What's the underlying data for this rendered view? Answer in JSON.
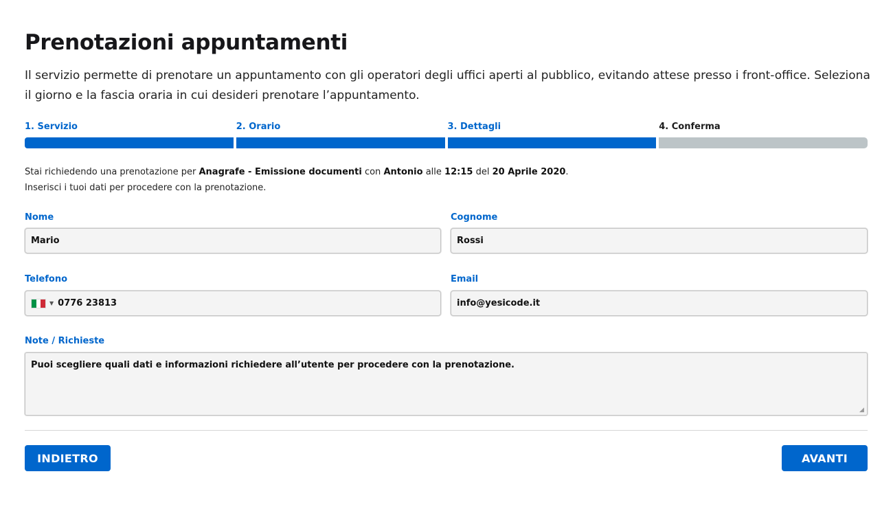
{
  "page": {
    "title": "Prenotazioni appuntamenti",
    "intro": "Il servizio permette di prenotare un appuntamento con gli operatori degli uffici aperti al pubblico, evitando attese presso i front-office. Seleziona il giorno e la fascia oraria in cui desideri prenotare l’appuntamento."
  },
  "steps": [
    {
      "label": "1. Servizio",
      "status": "done"
    },
    {
      "label": "2. Orario",
      "status": "done"
    },
    {
      "label": "3. Dettagli",
      "status": "done"
    },
    {
      "label": "4. Conferma",
      "status": "todo"
    }
  ],
  "summary": {
    "prefix": "Stai richiedendo una prenotazione per",
    "service": "Anagrafe - Emissione documenti",
    "with_word": "con",
    "operator": "Antonio",
    "at_word": "alle",
    "time": "12:15",
    "of_word": "del",
    "date": "20 Aprile 2020",
    "period": ".",
    "line2": "Inserisci i tuoi dati per procedere con la prenotazione."
  },
  "form": {
    "nome": {
      "label": "Nome",
      "value": "Mario"
    },
    "cognome": {
      "label": "Cognome",
      "value": "Rossi"
    },
    "telefono": {
      "label": "Telefono",
      "value": "0776 23813",
      "country_flag": "italy-flag-icon"
    },
    "email": {
      "label": "Email",
      "value": "info@yesicode.it"
    },
    "note": {
      "label": "Note / Richieste",
      "value": "Puoi scegliere quali dati e informazioni richiedere all’utente per procedere con la prenotazione."
    }
  },
  "buttons": {
    "back": "INDIETRO",
    "next": "AVANTI"
  },
  "colors": {
    "accent": "#0066cc",
    "step_pending": "#bcc4c7",
    "flag_green": "#009246",
    "flag_white": "#ffffff",
    "flag_red": "#ce2b37"
  }
}
